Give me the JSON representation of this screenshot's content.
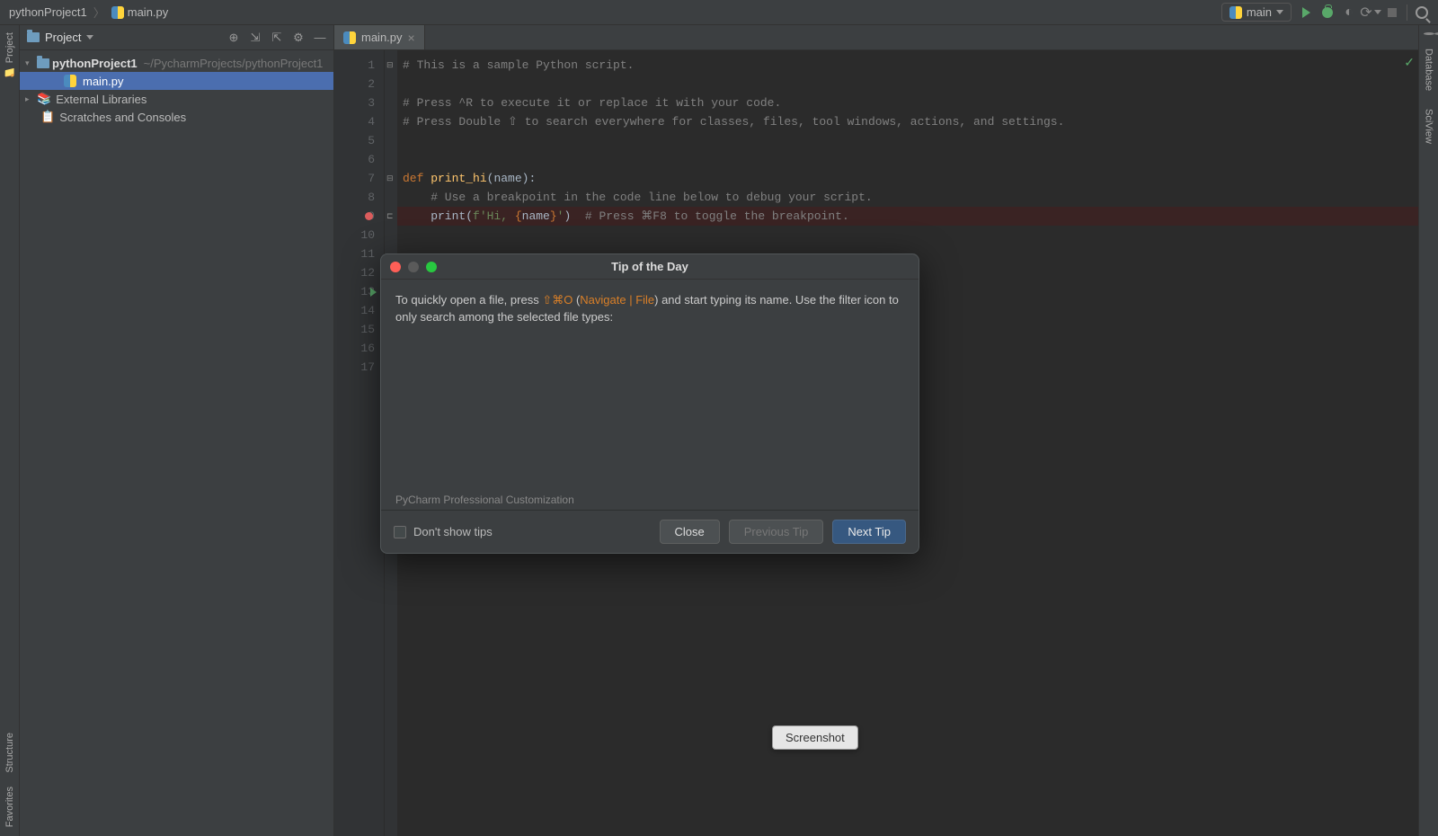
{
  "breadcrumbs": {
    "project": "pythonProject1",
    "file": "main.py"
  },
  "run_config": {
    "name": "main"
  },
  "project_panel": {
    "title": "Project",
    "root": "pythonProject1",
    "root_path": "~/PycharmProjects/pythonProject1",
    "file": "main.py",
    "external": "External Libraries",
    "scratches": "Scratches and Consoles"
  },
  "tabs": {
    "file": "main.py"
  },
  "side_tools": {
    "project": "Project",
    "structure": "Structure",
    "favorites": "Favorites",
    "database": "Database",
    "sciview": "SciView"
  },
  "code": {
    "l1": "# This is a sample Python script.",
    "l3": "# Press ^R to execute it or replace it with your code.",
    "l4": "# Press Double ⇧ to search everywhere for classes, files, tool windows, actions, and settings.",
    "l7a": "def ",
    "l7b": "print_hi",
    "l7c": "(name):",
    "l8": "    # Use a breakpoint in the code line below to debug your script.",
    "l9a": "    print(",
    "l9b": "f'Hi, ",
    "l9c": "{",
    "l9d": "name",
    "l9e": "}",
    "l9f": "'",
    "l9g": ")",
    "l9h": "  # Press ⌘F8 to toggle the breakpoint."
  },
  "dialog": {
    "title": "Tip of the Day",
    "body_pre": "To quickly open a file, press ",
    "shortcut": "⇧⌘O",
    "body_mid1": " (",
    "nav_link": "Navigate | File",
    "body_mid2": ") and start typing its name. Use the filter icon to only search among the selected file types:",
    "subtitle": "PyCharm Professional Customization",
    "dont_show": "Don't show tips",
    "close": "Close",
    "prev": "Previous Tip",
    "next": "Next Tip"
  },
  "tooltip": "Screenshot"
}
